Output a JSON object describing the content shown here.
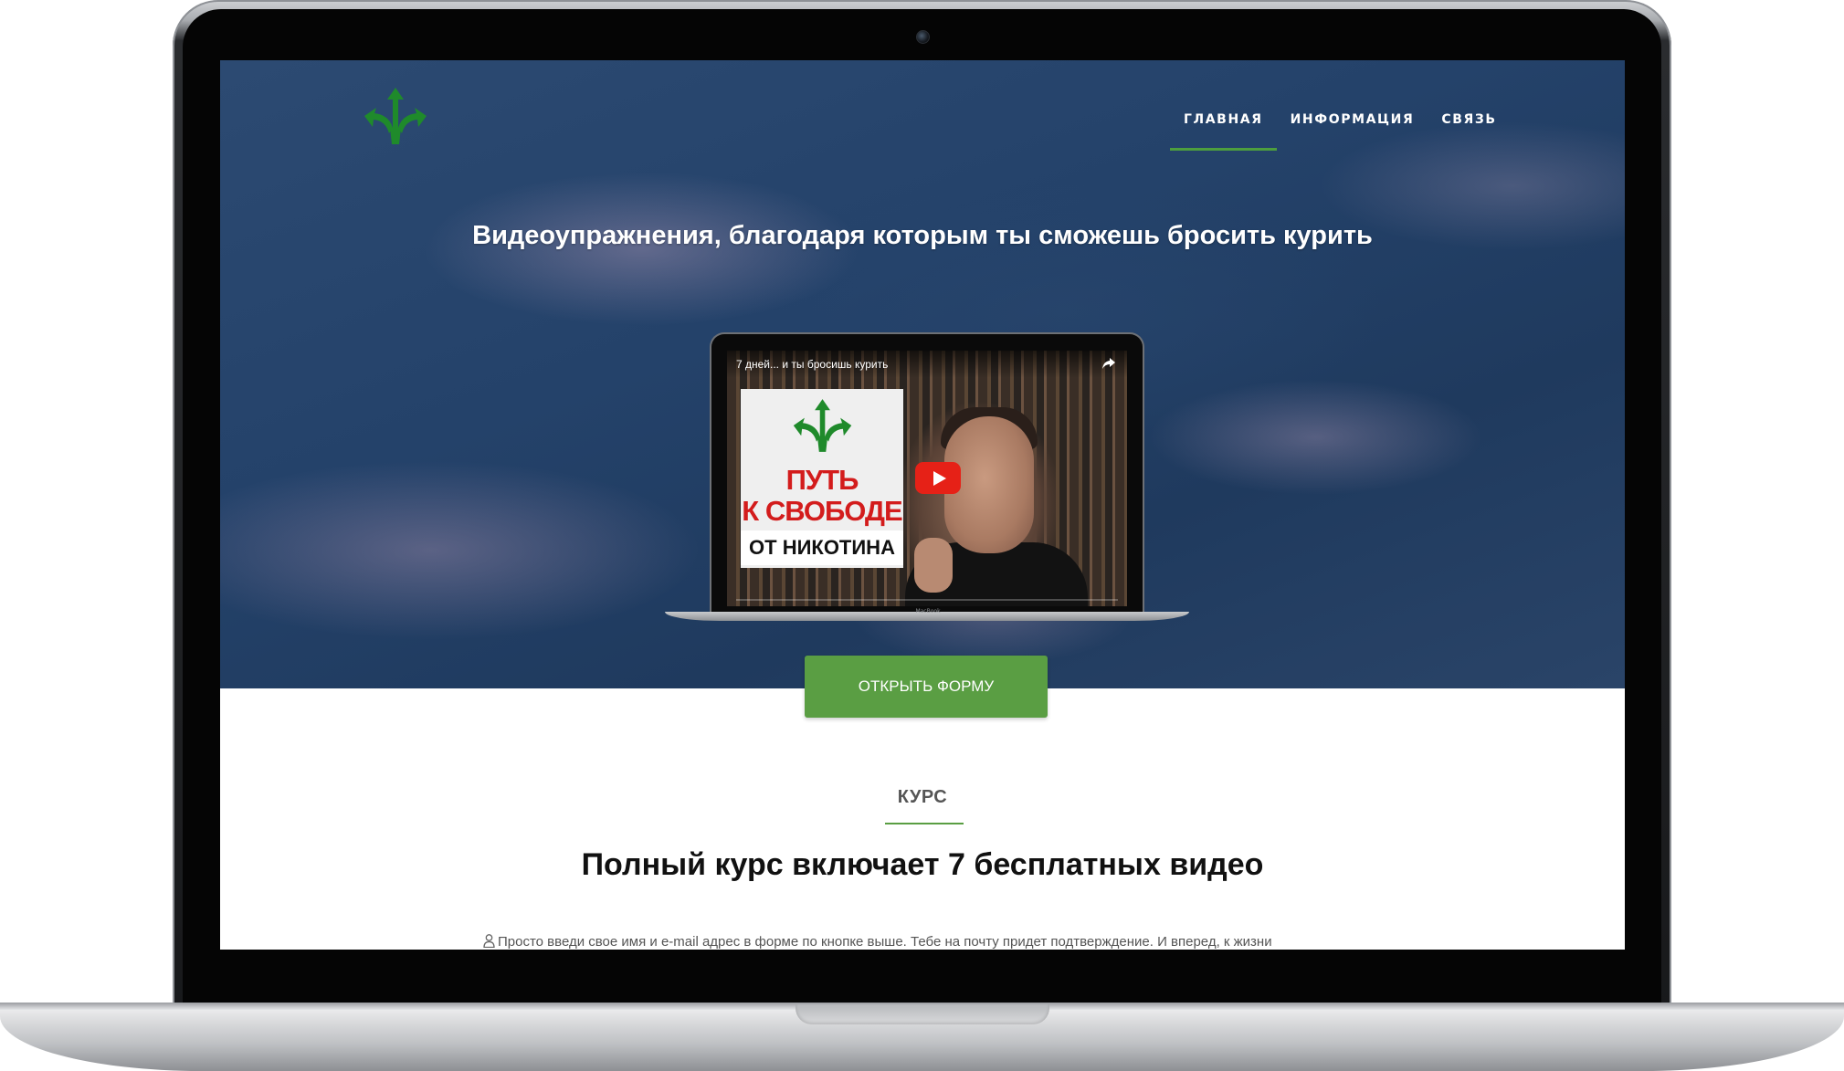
{
  "nav": {
    "items": [
      {
        "label": "ГЛАВНАЯ",
        "active": true
      },
      {
        "label": "ИНФОРМАЦИЯ",
        "active": false
      },
      {
        "label": "СВЯЗЬ",
        "active": false
      }
    ]
  },
  "hero": {
    "title": "Видеоупражнения, благодаря которым ты сможешь бросить курить",
    "video": {
      "title": "7 дней... и ты бросишь курить",
      "thumb_line1": "ПУТЬ",
      "thumb_line2": "К СВОБОДЕ",
      "thumb_line3": "ОТ НИКОТИНА",
      "device_brand": "MacBook"
    },
    "cta_label": "ОТКРЫТЬ ФОРМУ"
  },
  "course": {
    "label": "КУРС",
    "heading": "Полный курс включает 7 бесплатных видео",
    "text": "Просто введи свое имя и e-mail адрес в форме по кнопке выше. Тебе на почту придет подтверждение. И вперед, к жизни"
  },
  "colors": {
    "accent": "#5a9e43",
    "logo_green": "#1f8a2b",
    "play_red": "#e62117",
    "thumb_red": "#d31c1c"
  },
  "icons": {
    "logo": "arrows-logo-icon",
    "share": "share-icon",
    "play": "play-icon",
    "user": "user-icon"
  }
}
